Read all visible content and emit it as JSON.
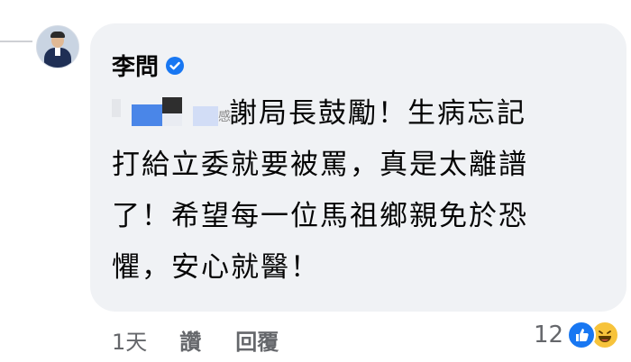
{
  "comment": {
    "author": "李問",
    "text_line1_suffix": "謝局長鼓勵！生病忘記",
    "text_line2": "打給立委就要被罵，真是太離譜",
    "text_line3": "了！希望每一位馬祖鄉親免於恐",
    "text_line4": "懼，安心就醫！",
    "redaction_fragment": "感",
    "time": "1天",
    "like_label": "讚",
    "reply_label": "回覆",
    "reaction_count": "12"
  },
  "icons": {
    "verified": "verified-badge-icon",
    "like_reaction": "like-reaction-icon",
    "haha_reaction": "haha-reaction-icon"
  },
  "colors": {
    "bubble": "#f0f2f5",
    "verified": "#1877f2",
    "meta_text": "#65676b"
  }
}
